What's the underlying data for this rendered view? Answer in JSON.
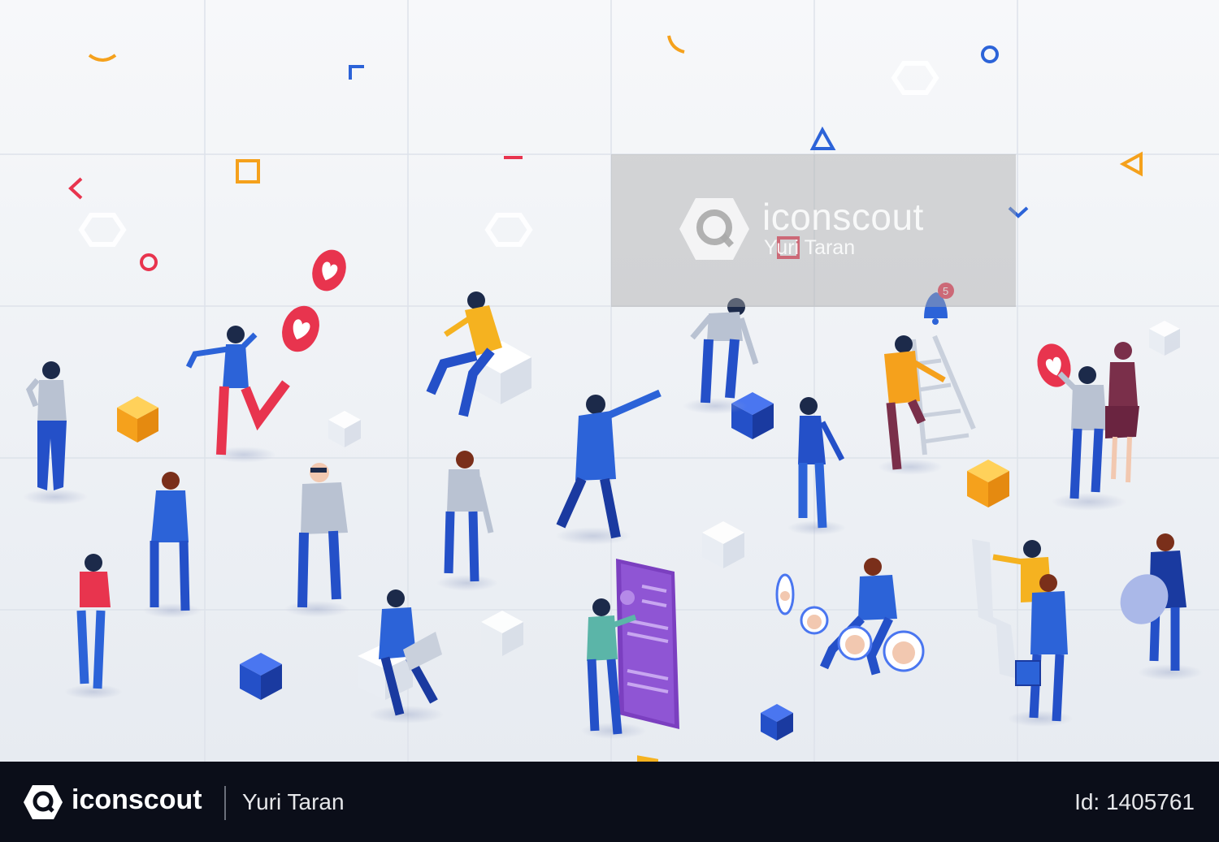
{
  "watermark": {
    "brand": "iconscout",
    "author": "Yuri Taran"
  },
  "footer": {
    "brand": "iconscout",
    "author": "Yuri Taran",
    "id_text": "Id: 1405761"
  },
  "colors": {
    "background": "#eef1f5",
    "footer_bg": "#0b0e19",
    "primary_blue": "#2450c8",
    "heart_red": "#e8344e",
    "accent_orange": "#f5a11c",
    "purple_phone": "#7b3fc0"
  },
  "notification_badge": "5",
  "icons": [
    "heart-icon",
    "bell-icon",
    "iconscout-logo",
    "face-avatar-icon"
  ]
}
